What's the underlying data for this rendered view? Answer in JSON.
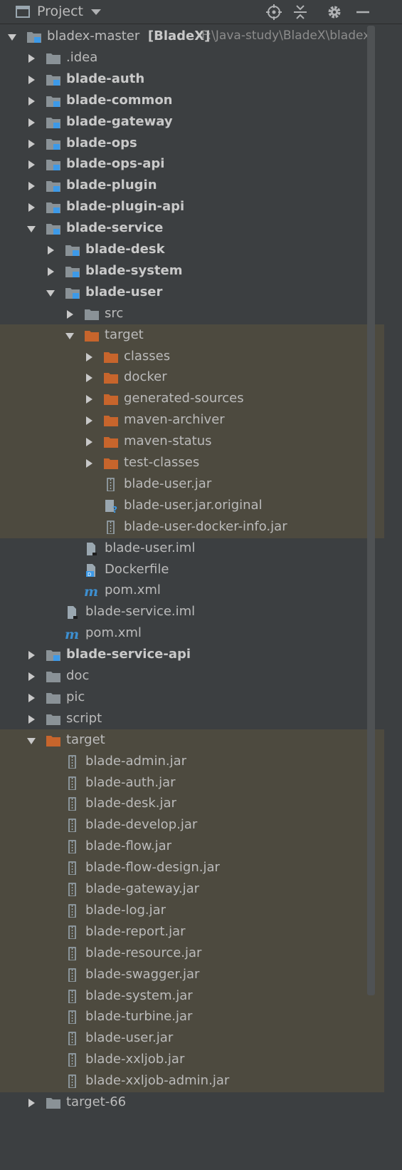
{
  "panel": {
    "title": "Project",
    "icons": {
      "window": "project-window-icon",
      "dropdown": "chevron-down-icon",
      "locate": "crosshair-icon",
      "collapse": "collapse-all-icon",
      "settings": "gear-icon",
      "hide": "minimize-icon"
    }
  },
  "colors": {
    "background": "#3c3f41",
    "highlight": "#4d4a3f",
    "folder_gray": "#8a9297",
    "folder_orange": "#c7652c",
    "module_badge": "#3d9ae8",
    "text": "#bbbbbb"
  },
  "tree": [
    {
      "label": "bladex-master",
      "suffix": "[BladeX]",
      "path": "F:\\Java-study\\BladeX\\bladex",
      "depth": 0,
      "arrow": "open",
      "icon": "module",
      "bold": false
    },
    {
      "label": ".idea",
      "depth": 1,
      "arrow": "closed",
      "icon": "folder"
    },
    {
      "label": "blade-auth",
      "depth": 1,
      "arrow": "closed",
      "icon": "module",
      "bold": true
    },
    {
      "label": "blade-common",
      "depth": 1,
      "arrow": "closed",
      "icon": "module",
      "bold": true
    },
    {
      "label": "blade-gateway",
      "depth": 1,
      "arrow": "closed",
      "icon": "module",
      "bold": true
    },
    {
      "label": "blade-ops",
      "depth": 1,
      "arrow": "closed",
      "icon": "module",
      "bold": true
    },
    {
      "label": "blade-ops-api",
      "depth": 1,
      "arrow": "closed",
      "icon": "module",
      "bold": true
    },
    {
      "label": "blade-plugin",
      "depth": 1,
      "arrow": "closed",
      "icon": "module",
      "bold": true
    },
    {
      "label": "blade-plugin-api",
      "depth": 1,
      "arrow": "closed",
      "icon": "module",
      "bold": true
    },
    {
      "label": "blade-service",
      "depth": 1,
      "arrow": "open",
      "icon": "module",
      "bold": true
    },
    {
      "label": "blade-desk",
      "depth": 2,
      "arrow": "closed",
      "icon": "module",
      "bold": true
    },
    {
      "label": "blade-system",
      "depth": 2,
      "arrow": "closed",
      "icon": "module",
      "bold": true
    },
    {
      "label": "blade-user",
      "depth": 2,
      "arrow": "open",
      "icon": "module",
      "bold": true
    },
    {
      "label": "src",
      "depth": 3,
      "arrow": "closed",
      "icon": "folder"
    },
    {
      "label": "target",
      "depth": 3,
      "arrow": "open",
      "icon": "folder-orange",
      "hl": true
    },
    {
      "label": "classes",
      "depth": 4,
      "arrow": "closed",
      "icon": "folder-orange",
      "hl": true
    },
    {
      "label": "docker",
      "depth": 4,
      "arrow": "closed",
      "icon": "folder-orange",
      "hl": true
    },
    {
      "label": "generated-sources",
      "depth": 4,
      "arrow": "closed",
      "icon": "folder-orange",
      "hl": true
    },
    {
      "label": "maven-archiver",
      "depth": 4,
      "arrow": "closed",
      "icon": "folder-orange",
      "hl": true
    },
    {
      "label": "maven-status",
      "depth": 4,
      "arrow": "closed",
      "icon": "folder-orange",
      "hl": true
    },
    {
      "label": "test-classes",
      "depth": 4,
      "arrow": "closed",
      "icon": "folder-orange",
      "hl": true
    },
    {
      "label": "blade-user.jar",
      "depth": 4,
      "arrow": "none",
      "icon": "jar",
      "hl": true
    },
    {
      "label": "blade-user.jar.original",
      "depth": 4,
      "arrow": "none",
      "icon": "unknown",
      "hl": true
    },
    {
      "label": "blade-user-docker-info.jar",
      "depth": 4,
      "arrow": "none",
      "icon": "jar",
      "hl": true
    },
    {
      "label": "blade-user.iml",
      "depth": 3,
      "arrow": "none",
      "icon": "iml"
    },
    {
      "label": "Dockerfile",
      "depth": 3,
      "arrow": "none",
      "icon": "dockerfile"
    },
    {
      "label": "pom.xml",
      "depth": 3,
      "arrow": "none",
      "icon": "maven"
    },
    {
      "label": "blade-service.iml",
      "depth": 2,
      "arrow": "none",
      "icon": "iml"
    },
    {
      "label": "pom.xml",
      "depth": 2,
      "arrow": "none",
      "icon": "maven"
    },
    {
      "label": "blade-service-api",
      "depth": 1,
      "arrow": "closed",
      "icon": "module",
      "bold": true
    },
    {
      "label": "doc",
      "depth": 1,
      "arrow": "closed",
      "icon": "folder"
    },
    {
      "label": "pic",
      "depth": 1,
      "arrow": "closed",
      "icon": "folder"
    },
    {
      "label": "script",
      "depth": 1,
      "arrow": "closed",
      "icon": "folder"
    },
    {
      "label": "target",
      "depth": 1,
      "arrow": "open",
      "icon": "folder-orange",
      "hl": true
    },
    {
      "label": "blade-admin.jar",
      "depth": 2,
      "arrow": "none",
      "icon": "jar",
      "hl": true
    },
    {
      "label": "blade-auth.jar",
      "depth": 2,
      "arrow": "none",
      "icon": "jar",
      "hl": true
    },
    {
      "label": "blade-desk.jar",
      "depth": 2,
      "arrow": "none",
      "icon": "jar",
      "hl": true
    },
    {
      "label": "blade-develop.jar",
      "depth": 2,
      "arrow": "none",
      "icon": "jar",
      "hl": true
    },
    {
      "label": "blade-flow.jar",
      "depth": 2,
      "arrow": "none",
      "icon": "jar",
      "hl": true
    },
    {
      "label": "blade-flow-design.jar",
      "depth": 2,
      "arrow": "none",
      "icon": "jar",
      "hl": true
    },
    {
      "label": "blade-gateway.jar",
      "depth": 2,
      "arrow": "none",
      "icon": "jar",
      "hl": true
    },
    {
      "label": "blade-log.jar",
      "depth": 2,
      "arrow": "none",
      "icon": "jar",
      "hl": true
    },
    {
      "label": "blade-report.jar",
      "depth": 2,
      "arrow": "none",
      "icon": "jar",
      "hl": true
    },
    {
      "label": "blade-resource.jar",
      "depth": 2,
      "arrow": "none",
      "icon": "jar",
      "hl": true
    },
    {
      "label": "blade-swagger.jar",
      "depth": 2,
      "arrow": "none",
      "icon": "jar",
      "hl": true
    },
    {
      "label": "blade-system.jar",
      "depth": 2,
      "arrow": "none",
      "icon": "jar",
      "hl": true
    },
    {
      "label": "blade-turbine.jar",
      "depth": 2,
      "arrow": "none",
      "icon": "jar",
      "hl": true
    },
    {
      "label": "blade-user.jar",
      "depth": 2,
      "arrow": "none",
      "icon": "jar",
      "hl": true
    },
    {
      "label": "blade-xxljob.jar",
      "depth": 2,
      "arrow": "none",
      "icon": "jar",
      "hl": true
    },
    {
      "label": "blade-xxljob-admin.jar",
      "depth": 2,
      "arrow": "none",
      "icon": "jar",
      "hl": true
    },
    {
      "label": "target-66",
      "depth": 1,
      "arrow": "closed",
      "icon": "folder"
    }
  ]
}
